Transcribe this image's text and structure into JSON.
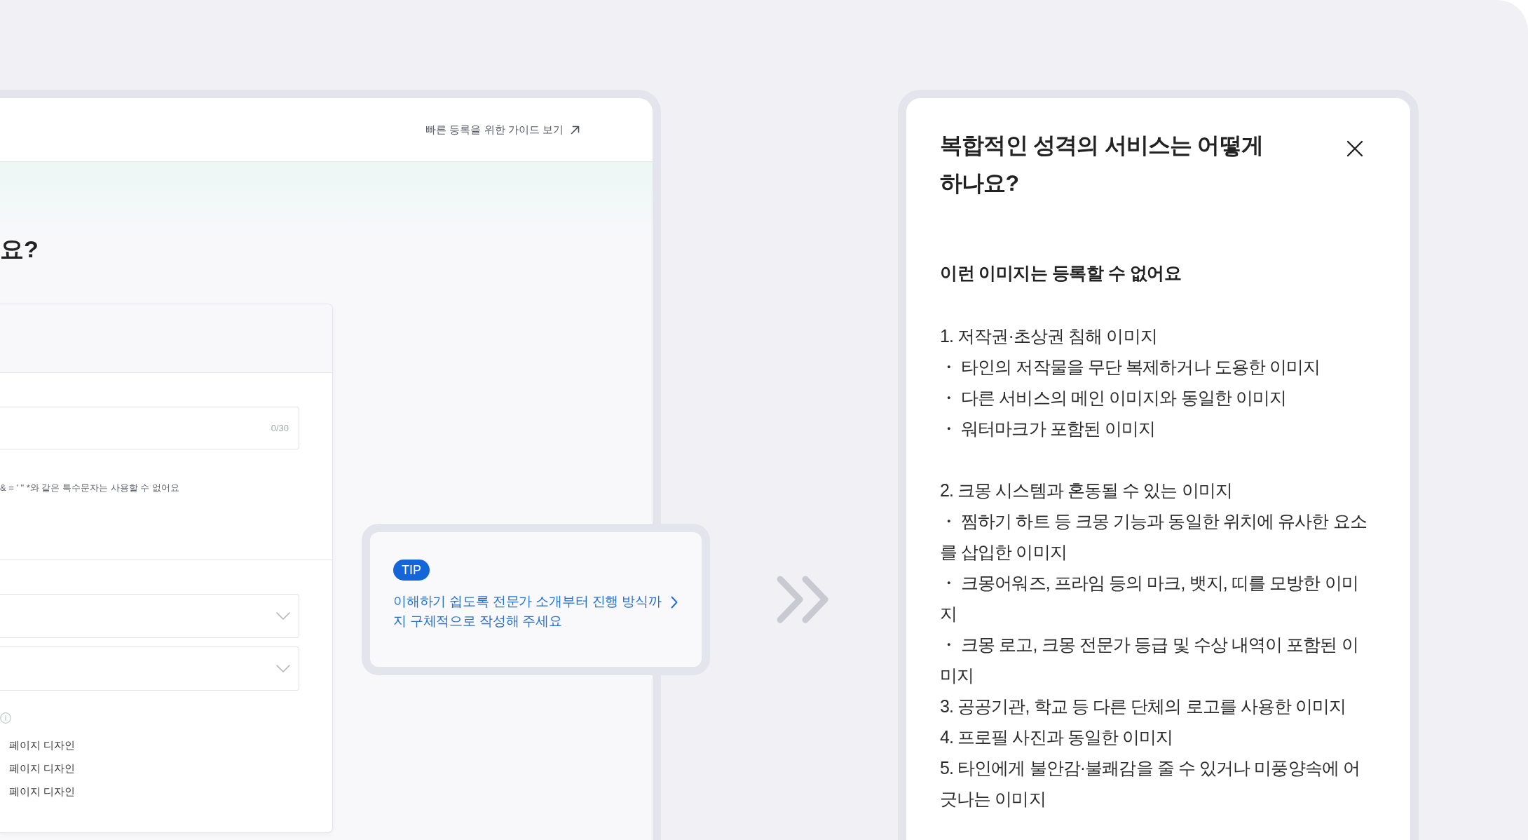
{
  "guide_panel": {
    "guide_link": {
      "label": "빠른 등록을 위한 가이드 보기"
    },
    "heading": "요?",
    "form_card": {
      "title_input": {
        "counter": "0/30"
      },
      "helper_text": "& = ' \" *와 같은 특수문자는 사용할 수 없어요",
      "examples": [
        "페이지 디자인",
        "페이지 디자인",
        "페이지 디자인"
      ]
    }
  },
  "tip_card": {
    "badge": "TIP",
    "text": "이해하기 쉽도록 전문가 소개부터 진행 방식까지 구체적으로 작성해 주세요"
  },
  "help_panel": {
    "title": "복합적인 성격의 서비스는 어떻게 하나요?",
    "subtitle": "이런 이미지는 등록할 수 없어요",
    "groups": [
      {
        "lines": [
          "1. 저작권·초상권 침해 이미지",
          "・ 타인의 저작물을 무단 복제하거나 도용한 이미지",
          "・ 다른 서비스의 메인 이미지와 동일한 이미지",
          "・ 워터마크가 포함된 이미지"
        ]
      },
      {
        "lines": [
          "2. 크몽 시스템과 혼동될 수 있는 이미지",
          "・ 찜하기 하트 등 크몽 기능과 동일한 위치에 유사한 요소를 삽입한 이미지",
          "・ 크몽어워즈, 프라임 등의 마크, 뱃지, 띠를 모방한 이미지",
          "・ 크몽 로고, 크몽 전문가 등급 및 수상 내역이 포함된 이미지",
          "3. 공공기관, 학교 등 다른 단체의 로고를 사용한 이미지",
          "4. 프로필 사진과 동일한 이미지",
          "5. 타인에게 불안감·불쾌감을 줄 수 있거나 미풍양속에 어긋나는 이미지"
        ]
      }
    ]
  }
}
